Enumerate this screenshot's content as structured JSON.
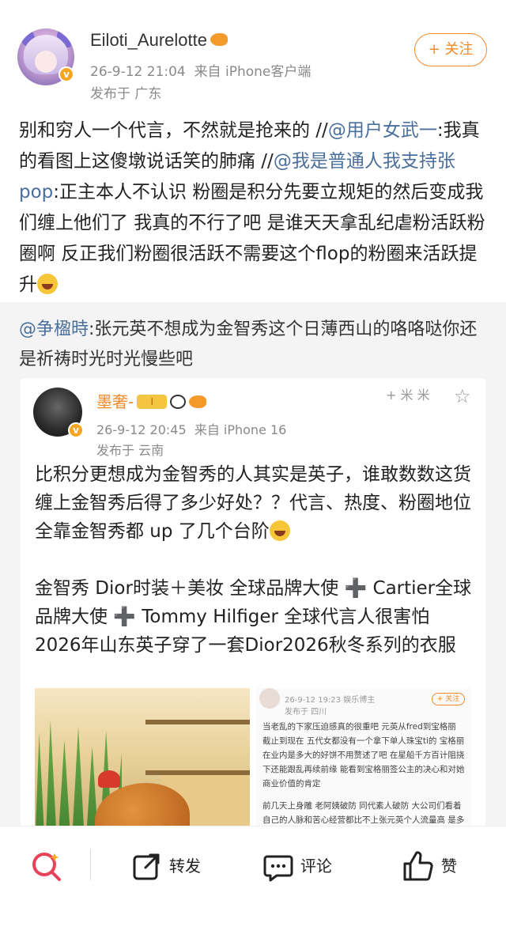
{
  "header": {
    "username": "Eiloti_Aurelotte",
    "timestamp": "26-9-12 21:04",
    "source": "来自 iPhone客户端",
    "location": "发布于 广东",
    "follow_label": "+ 关注"
  },
  "post": {
    "line1_pre": "别和穷人一个代言，不然就是抢来的 //",
    "mention1": "@用户女武一",
    "line1_post": ":",
    "line2_pre": "我真的看图上这傻墩说话笑的肺痛 //",
    "mention2": "@我是普通人我支持张pop",
    "body": ":正主本人不认识 粉圈是积分先要立规矩的然后变成我们缠上他们了 我真的不行了吧 是谁天天拿乱纪虐粉活跃粉圈啊 反正我们粉圈很活跃不需要这个flop的粉圈来活跃提升"
  },
  "quote": {
    "mention": "@争楹時",
    "text": ":张元英不想成为金智秀这个日薄西山的咯咯哒你还是祈祷时光时光慢些吧"
  },
  "card": {
    "name": "墨奢-",
    "level": "I",
    "timestamp": "26-9-12 20:45",
    "source": "来自 iPhone 16",
    "location": "发布于 云南",
    "decoration": "+ 米 米",
    "paragraph1": "比积分更想成为金智秀的人其实是英子，谁敢数数这货缠上金智秀后得了多少好处？？代言、热度、粉圈地位全靠金智秀都 up 了几个台阶",
    "paragraph2": "金智秀 Dior时装＋美妆 全球品牌大使 ➕ Cartier全球品牌大使 ➕ Tommy Hilfiger 全球代言人很害怕2026年山东英子穿了一套Dior2026秋冬系列的衣服"
  },
  "screenshot_image": {
    "meta": "26-9-12 19:23  娱乐博主",
    "meta2": "发布于 四川",
    "follow": "+ 关注",
    "p1": "当老乱的下家压迫感真的很重吧 元英从fred到宝格丽 截止到现在 五代女都没有一个拿下单人珠宝ti的 宝格丽在业内是多大的好饼不用赘述了吧 在星船千方百计阻挠下还能跟乱再续前缘 能看到宝格丽签公主的决心和对她商业价值的肯定",
    "p2": "前几天上身雕 老阿姨破防 同代素人破防 大公司们看着自己的人脉和苦心经营都比不上张元英个人流量高 是多的糖还香 可是归归到事情的本质 张元英是"
  },
  "toolbar": {
    "repost_label": "转发",
    "comment_label": "评论",
    "like_label": "赞"
  },
  "colors": {
    "accent": "#f28a2a",
    "link": "#4a6f9c",
    "search_icon": "#e8425b"
  }
}
